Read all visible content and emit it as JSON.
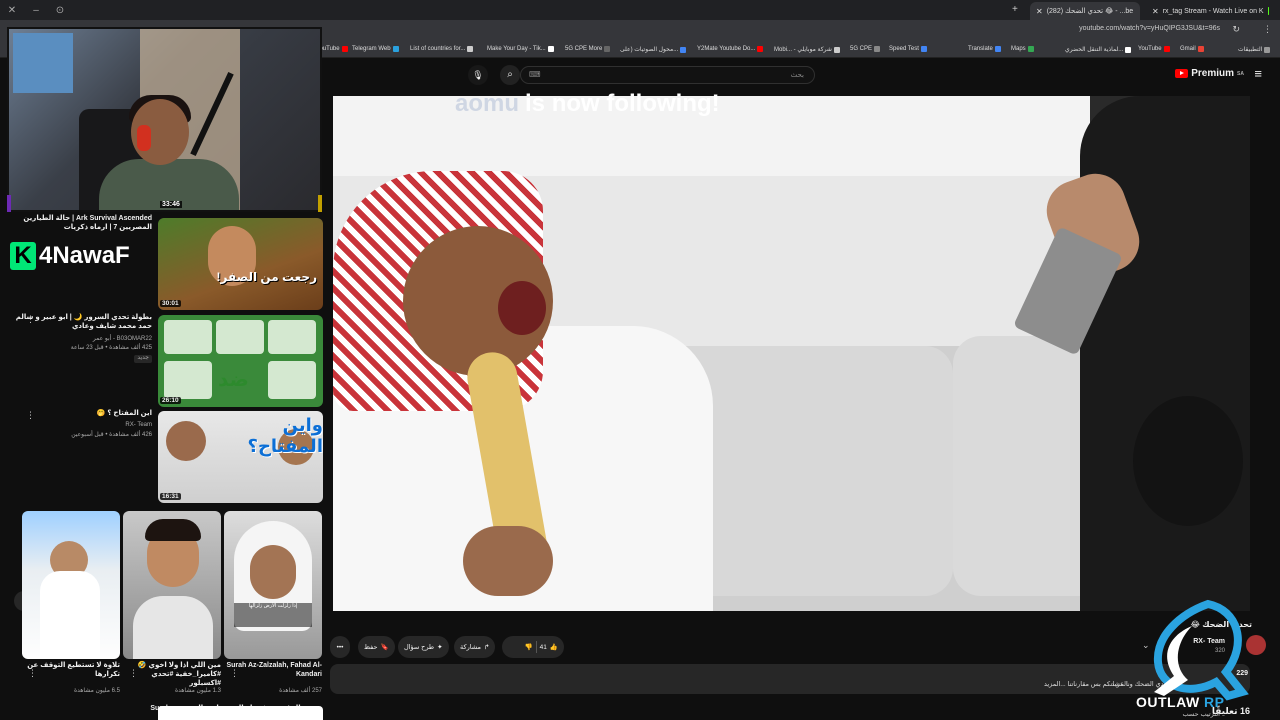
{
  "browser": {
    "tabs": [
      {
        "label": "(282) تحدي الضحك 😂 - ...be",
        "active": true
      },
      {
        "label": "rx_tag Stream - Watch Live on K",
        "active": false
      }
    ],
    "url": "youtube.com/watch?v=yHuQIPG3JSU&t=96s",
    "bookmarks": [
      "YouTube",
      "Telegram Web",
      "List of countries for...",
      "Make Your Day - Tik...",
      "5G CPE More",
      "محول الصوتيات (على...",
      "Y2Mate Youtube Do...",
      "Mobi... - شركة موبايلي",
      "5G CPE",
      "Speed Test",
      "Translate",
      "Maps",
      "لماذية التنقل الحضري...",
      "YouTube",
      "Gmail",
      "التطبيقات"
    ]
  },
  "header": {
    "search_placeholder": "بحث",
    "logo": "Premium",
    "logo_suffix": "SA"
  },
  "webcam": {
    "timer": "33:46"
  },
  "sidebar": {
    "top_title": "Ark Survival Ascended | حالة الطيارين المصريين 7 | ارماه ذكريات",
    "k4_logo": "4NawaF",
    "recs": [
      {
        "title": "",
        "meta_line1": "",
        "meta_line2": "",
        "duration": "30:01"
      },
      {
        "title": "بطولة تحدي السرور 🌙 | ابو عبير و سالم حمد محمد شايف وعادي",
        "meta_line1": "B03OMAR22 - أبو عمر",
        "meta_line2": "425 ألف مشاهدة • قبل 23 ساعة",
        "badge": "جديد",
        "duration": "26:10"
      },
      {
        "title": "اين المفتاح ؟ 🤭",
        "meta_line1": "RX- Team",
        "meta_line2": "426 ألف مشاهدة • قبل أسبوعين",
        "duration": "16:31"
      }
    ]
  },
  "shorts": [
    {
      "title": "Surah Az-Zalzalah, Fahad Al-Kandari",
      "views": "257 ألف مشاهدة"
    },
    {
      "title": "مين اللي اذا ولا اخوي 🤣 #كاميرا_خفية #تحدي #اكسبلور",
      "views": "1.3 مليون مشاهدة"
    },
    {
      "title": "تلاوة لا تستطيع التوقف عن تكرارها",
      "views": "6.5 مليون مشاهدة"
    }
  ],
  "player": {
    "alert_user": "aomu",
    "alert_text": "is now following!"
  },
  "video": {
    "title": "تحدي الضحك 😂",
    "channel": "RX- Team",
    "subscribers": "320",
    "likes": "41",
    "share_label": "مشاركة",
    "ask_label": "طرح سؤال",
    "save_label": "حفظ",
    "views": "229",
    "description": "تحدي الضحك ونا عشانكم بس مقارناتنا ...المزيد",
    "more_label": "...المزيد",
    "comments_count": "16 تعليقًا",
    "sort_label": "الترتيب حسب"
  },
  "watermark": {
    "brand": "OUTLAW",
    "suffix": "RP"
  },
  "bottom_rec": {
    "title": "سورة المؤمنون فضيلة الشيخ ياسر الدوسري Surah"
  }
}
